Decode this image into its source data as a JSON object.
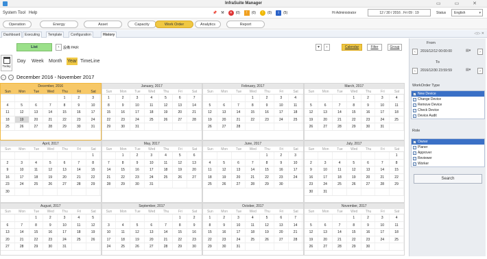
{
  "window": {
    "title": "InfraSuite Manager"
  },
  "menu": {
    "items": [
      "System",
      "Tool",
      "Help"
    ]
  },
  "status_bar": {
    "counts": [
      "(0)",
      "(0)",
      "(0)",
      "(5)"
    ],
    "user": "Hi Administrator",
    "date": "12 / 30 / 2016 . Fri   09 : 19",
    "status_label": "Status",
    "language": "English"
  },
  "nav": {
    "buttons": [
      "Operation",
      "Energy",
      "Asset",
      "Capacity",
      "Work Order",
      "Analytics",
      "Report"
    ],
    "active": "Work Order"
  },
  "tabs": {
    "items": [
      "Dashboard",
      "Executing",
      "Template",
      "Configuration",
      "History"
    ],
    "active": "History"
  },
  "toolbar": {
    "list_label": "List",
    "pair_label": "設備 PAIR",
    "calendar": "Calendar",
    "filter": "Filter",
    "group": "Group"
  },
  "views": {
    "today_label": "Today",
    "items": [
      "Day",
      "Week",
      "Month",
      "Year",
      "TimeLine"
    ],
    "active": "Year"
  },
  "range_title": "December 2016 - November 2017",
  "calendar": {
    "days_of_week": [
      "Sun",
      "Mon",
      "Tue",
      "Wed",
      "Thu",
      "Fri",
      "Sat"
    ],
    "months": [
      {
        "name": "December, 2016",
        "current": true,
        "weeks": [
          [
            "",
            "",
            "",
            "",
            "1",
            "2",
            "3"
          ],
          [
            "4",
            "5",
            "6",
            "7",
            "8",
            "9",
            "10"
          ],
          [
            "11",
            "12",
            "13",
            "14",
            "15",
            "16",
            "17"
          ],
          [
            "18",
            "19",
            "20",
            "21",
            "22",
            "23",
            "24"
          ],
          [
            "25",
            "26",
            "27",
            "28",
            "29",
            "30",
            "31"
          ]
        ]
      },
      {
        "name": "January, 2017",
        "weeks": [
          [
            "1",
            "2",
            "3",
            "4",
            "5",
            "6",
            "7"
          ],
          [
            "8",
            "9",
            "10",
            "11",
            "12",
            "13",
            "14"
          ],
          [
            "15",
            "16",
            "17",
            "18",
            "19",
            "20",
            "21"
          ],
          [
            "22",
            "23",
            "24",
            "25",
            "26",
            "27",
            "28"
          ],
          [
            "29",
            "30",
            "31",
            "",
            "",
            "",
            ""
          ]
        ]
      },
      {
        "name": "February, 2017",
        "weeks": [
          [
            "",
            "",
            "",
            "1",
            "2",
            "3",
            "4"
          ],
          [
            "5",
            "6",
            "7",
            "8",
            "9",
            "10",
            "11"
          ],
          [
            "12",
            "13",
            "14",
            "15",
            "16",
            "17",
            "18"
          ],
          [
            "19",
            "20",
            "21",
            "22",
            "23",
            "24",
            "25"
          ],
          [
            "26",
            "27",
            "28",
            "",
            "",
            "",
            ""
          ]
        ]
      },
      {
        "name": "March, 2017",
        "weeks": [
          [
            "",
            "",
            "",
            "1",
            "2",
            "3",
            "4"
          ],
          [
            "5",
            "6",
            "7",
            "8",
            "9",
            "10",
            "11"
          ],
          [
            "12",
            "13",
            "14",
            "15",
            "16",
            "17",
            "18"
          ],
          [
            "19",
            "20",
            "21",
            "22",
            "23",
            "24",
            "25"
          ],
          [
            "26",
            "27",
            "28",
            "29",
            "30",
            "31",
            ""
          ]
        ]
      },
      {
        "name": "April, 2017",
        "weeks": [
          [
            "",
            "",
            "",
            "",
            "",
            "",
            "1"
          ],
          [
            "2",
            "3",
            "4",
            "5",
            "6",
            "7",
            "8"
          ],
          [
            "9",
            "10",
            "11",
            "12",
            "13",
            "14",
            "15"
          ],
          [
            "16",
            "17",
            "18",
            "19",
            "20",
            "21",
            "22"
          ],
          [
            "23",
            "24",
            "25",
            "26",
            "27",
            "28",
            "29"
          ],
          [
            "30",
            "",
            "",
            "",
            "",
            "",
            ""
          ]
        ]
      },
      {
        "name": "May, 2017",
        "weeks": [
          [
            "",
            "1",
            "2",
            "3",
            "4",
            "5",
            "6"
          ],
          [
            "7",
            "8",
            "9",
            "10",
            "11",
            "12",
            "13"
          ],
          [
            "14",
            "15",
            "16",
            "17",
            "18",
            "19",
            "20"
          ],
          [
            "21",
            "22",
            "23",
            "24",
            "25",
            "26",
            "27"
          ],
          [
            "28",
            "29",
            "30",
            "31",
            "",
            "",
            ""
          ]
        ]
      },
      {
        "name": "June, 2017",
        "weeks": [
          [
            "",
            "",
            "",
            "",
            "1",
            "2",
            "3"
          ],
          [
            "4",
            "5",
            "6",
            "7",
            "8",
            "9",
            "10"
          ],
          [
            "11",
            "12",
            "13",
            "14",
            "15",
            "16",
            "17"
          ],
          [
            "18",
            "19",
            "20",
            "21",
            "22",
            "23",
            "24"
          ],
          [
            "25",
            "26",
            "27",
            "28",
            "29",
            "30",
            ""
          ]
        ]
      },
      {
        "name": "July, 2017",
        "weeks": [
          [
            "",
            "",
            "",
            "",
            "",
            "",
            "1"
          ],
          [
            "2",
            "3",
            "4",
            "5",
            "6",
            "7",
            "8"
          ],
          [
            "9",
            "10",
            "11",
            "12",
            "13",
            "14",
            "15"
          ],
          [
            "16",
            "17",
            "18",
            "19",
            "20",
            "21",
            "22"
          ],
          [
            "23",
            "24",
            "25",
            "26",
            "27",
            "28",
            "29"
          ],
          [
            "30",
            "31",
            "",
            "",
            "",
            "",
            ""
          ]
        ]
      },
      {
        "name": "August, 2017",
        "weeks": [
          [
            "",
            "",
            "1",
            "2",
            "3",
            "4",
            "5"
          ],
          [
            "6",
            "7",
            "8",
            "9",
            "10",
            "11",
            "12"
          ],
          [
            "13",
            "14",
            "15",
            "16",
            "17",
            "18",
            "19"
          ],
          [
            "20",
            "21",
            "22",
            "23",
            "24",
            "25",
            "26"
          ],
          [
            "27",
            "28",
            "29",
            "30",
            "31",
            "",
            ""
          ]
        ]
      },
      {
        "name": "September, 2017",
        "weeks": [
          [
            "",
            "",
            "",
            "",
            "",
            "1",
            "2"
          ],
          [
            "3",
            "4",
            "5",
            "6",
            "7",
            "8",
            "9"
          ],
          [
            "10",
            "11",
            "12",
            "13",
            "14",
            "15",
            "16"
          ],
          [
            "17",
            "18",
            "19",
            "20",
            "21",
            "22",
            "23"
          ],
          [
            "24",
            "25",
            "26",
            "27",
            "28",
            "29",
            "30"
          ]
        ]
      },
      {
        "name": "October, 2017",
        "weeks": [
          [
            "1",
            "2",
            "3",
            "4",
            "5",
            "6",
            "7"
          ],
          [
            "8",
            "9",
            "10",
            "11",
            "12",
            "13",
            "14"
          ],
          [
            "15",
            "16",
            "17",
            "18",
            "19",
            "20",
            "21"
          ],
          [
            "22",
            "23",
            "24",
            "25",
            "26",
            "27",
            "28"
          ],
          [
            "29",
            "30",
            "31",
            "",
            "",
            "",
            ""
          ]
        ]
      },
      {
        "name": "November, 2017",
        "weeks": [
          [
            "",
            "",
            "",
            "1",
            "2",
            "3",
            "4"
          ],
          [
            "5",
            "6",
            "7",
            "8",
            "9",
            "10",
            "11"
          ],
          [
            "12",
            "13",
            "14",
            "15",
            "16",
            "17",
            "18"
          ],
          [
            "19",
            "20",
            "21",
            "22",
            "23",
            "24",
            "25"
          ],
          [
            "26",
            "27",
            "28",
            "29",
            "30",
            "",
            ""
          ]
        ]
      }
    ],
    "today": {
      "month": 0,
      "day": "19"
    }
  },
  "filter_panel": {
    "from_label": "From",
    "from_value": "2016/12/12 00:00:00",
    "to_label": "To",
    "to_value": "2016/12/30 23:59:59",
    "workorder_type_label": "WorkOrder Type",
    "workorder_types": [
      "New Device",
      "Change Device",
      "Remove Device",
      "Check Device",
      "Device Audit"
    ],
    "role_label": "Role",
    "roles": [
      "Owner",
      "Planer",
      "Approver",
      "Reviewer",
      "Worker"
    ],
    "search_label": "Search"
  }
}
